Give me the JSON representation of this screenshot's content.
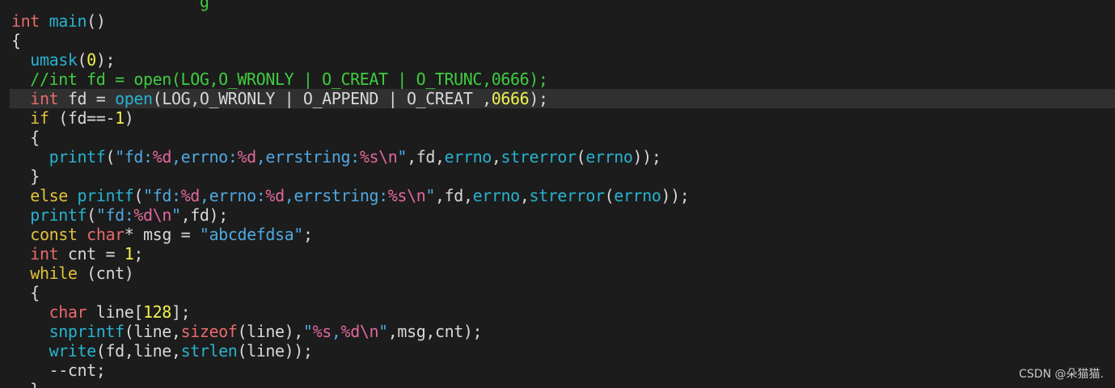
{
  "colors": {
    "background": "#1c1c1c",
    "current_line": "#303030",
    "plain": "#d8d8d8",
    "keyword": "#e2c23c",
    "type": "#ea6a6a",
    "func": "#27b2cf",
    "comment": "#3fcc3f",
    "string": "#4fa8e0",
    "format": "#e0689a",
    "number": "#f0f050"
  },
  "editor": {
    "current_line_index": 5,
    "lines": [
      [
        [
          "plain",
          "                    "
        ],
        [
          "comment",
          "g"
        ]
      ],
      [
        [
          "type",
          "int"
        ],
        [
          "plain",
          " "
        ],
        [
          "func",
          "main"
        ],
        [
          "plain",
          "()"
        ]
      ],
      [
        [
          "plain",
          "{"
        ]
      ],
      [
        [
          "plain",
          "  "
        ],
        [
          "func",
          "umask"
        ],
        [
          "plain",
          "("
        ],
        [
          "number",
          "0"
        ],
        [
          "plain",
          ");"
        ]
      ],
      [
        [
          "plain",
          "  "
        ],
        [
          "comment",
          "//int fd = open(LOG,O_WRONLY | O_CREAT | O_TRUNC,0666);"
        ]
      ],
      [
        [
          "plain",
          "  "
        ],
        [
          "type",
          "int"
        ],
        [
          "plain",
          " fd = "
        ],
        [
          "func",
          "open"
        ],
        [
          "plain",
          "(LOG,O_WRONLY | O_APPEND | O_CREAT ,"
        ],
        [
          "number",
          "0666"
        ],
        [
          "plain",
          ");"
        ]
      ],
      [
        [
          "plain",
          "  "
        ],
        [
          "keyword",
          "if"
        ],
        [
          "plain",
          " (fd==-"
        ],
        [
          "number",
          "1"
        ],
        [
          "plain",
          ")"
        ]
      ],
      [
        [
          "plain",
          "  {"
        ]
      ],
      [
        [
          "plain",
          "    "
        ],
        [
          "func",
          "printf"
        ],
        [
          "plain",
          "("
        ],
        [
          "string",
          "\"fd:"
        ],
        [
          "format",
          "%d"
        ],
        [
          "string",
          ",errno:"
        ],
        [
          "format",
          "%d"
        ],
        [
          "string",
          ",errstring:"
        ],
        [
          "format",
          "%s\\n"
        ],
        [
          "string",
          "\""
        ],
        [
          "plain",
          ",fd,"
        ],
        [
          "func",
          "errno"
        ],
        [
          "plain",
          ","
        ],
        [
          "func",
          "strerror"
        ],
        [
          "plain",
          "("
        ],
        [
          "func",
          "errno"
        ],
        [
          "plain",
          "));"
        ]
      ],
      [
        [
          "plain",
          "  }"
        ]
      ],
      [
        [
          "plain",
          "  "
        ],
        [
          "keyword",
          "else"
        ],
        [
          "plain",
          " "
        ],
        [
          "func",
          "printf"
        ],
        [
          "plain",
          "("
        ],
        [
          "string",
          "\"fd:"
        ],
        [
          "format",
          "%d"
        ],
        [
          "string",
          ",errno:"
        ],
        [
          "format",
          "%d"
        ],
        [
          "string",
          ",errstring:"
        ],
        [
          "format",
          "%s\\n"
        ],
        [
          "string",
          "\""
        ],
        [
          "plain",
          ",fd,"
        ],
        [
          "func",
          "errno"
        ],
        [
          "plain",
          ","
        ],
        [
          "func",
          "strerror"
        ],
        [
          "plain",
          "("
        ],
        [
          "func",
          "errno"
        ],
        [
          "plain",
          "));"
        ]
      ],
      [
        [
          "plain",
          "  "
        ],
        [
          "func",
          "printf"
        ],
        [
          "plain",
          "("
        ],
        [
          "string",
          "\"fd:"
        ],
        [
          "format",
          "%d\\n"
        ],
        [
          "string",
          "\""
        ],
        [
          "plain",
          ",fd);"
        ]
      ],
      [
        [
          "plain",
          "  "
        ],
        [
          "keyword",
          "const"
        ],
        [
          "plain",
          " "
        ],
        [
          "type",
          "char"
        ],
        [
          "plain",
          "* msg = "
        ],
        [
          "string",
          "\"abcdefdsa\""
        ],
        [
          "plain",
          ";"
        ]
      ],
      [
        [
          "plain",
          "  "
        ],
        [
          "type",
          "int"
        ],
        [
          "plain",
          " cnt = "
        ],
        [
          "number",
          "1"
        ],
        [
          "plain",
          ";"
        ]
      ],
      [
        [
          "plain",
          "  "
        ],
        [
          "keyword",
          "while"
        ],
        [
          "plain",
          " (cnt)"
        ]
      ],
      [
        [
          "plain",
          "  {"
        ]
      ],
      [
        [
          "plain",
          "    "
        ],
        [
          "type",
          "char"
        ],
        [
          "plain",
          " line["
        ],
        [
          "number",
          "128"
        ],
        [
          "plain",
          "];"
        ]
      ],
      [
        [
          "plain",
          "    "
        ],
        [
          "func",
          "snprintf"
        ],
        [
          "plain",
          "(line,"
        ],
        [
          "type",
          "sizeof"
        ],
        [
          "plain",
          "(line),"
        ],
        [
          "string",
          "\""
        ],
        [
          "format",
          "%s"
        ],
        [
          "string",
          ","
        ],
        [
          "format",
          "%d\\n"
        ],
        [
          "string",
          "\""
        ],
        [
          "plain",
          ",msg,cnt);"
        ]
      ],
      [
        [
          "plain",
          "    "
        ],
        [
          "func",
          "write"
        ],
        [
          "plain",
          "(fd,line,"
        ],
        [
          "func",
          "strlen"
        ],
        [
          "plain",
          "(line));"
        ]
      ],
      [
        [
          "plain",
          "    --cnt;"
        ]
      ],
      [
        [
          "plain",
          "  }"
        ]
      ]
    ]
  },
  "watermark": {
    "text": "CSDN @朵猫猫."
  }
}
